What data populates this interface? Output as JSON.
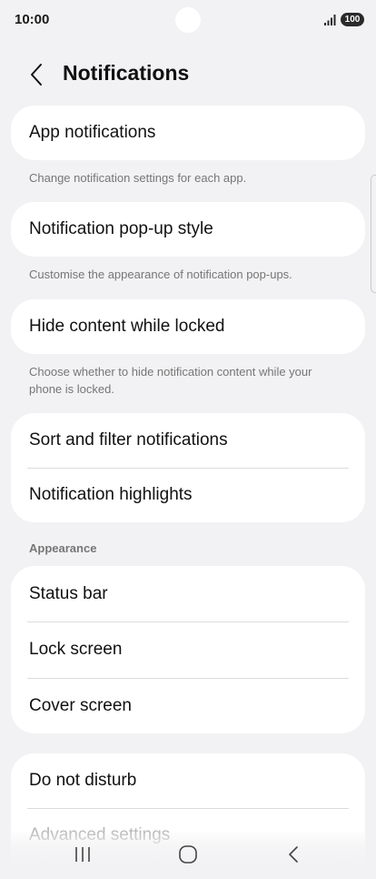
{
  "status_bar": {
    "time": "10:00",
    "battery": "100"
  },
  "header": {
    "title": "Notifications"
  },
  "groups": {
    "app_notifications": {
      "label": "App notifications",
      "desc": "Change notification settings for each app."
    },
    "popup_style": {
      "label": "Notification pop-up style",
      "desc": "Customise the appearance of notification pop-ups."
    },
    "hide_content": {
      "label": "Hide content while locked",
      "desc": "Choose whether to hide notification content while your phone is locked."
    },
    "sort_group": {
      "items": [
        "Sort and filter notifications",
        "Notification highlights"
      ]
    },
    "appearance": {
      "header": "Appearance",
      "items": [
        "Status bar",
        "Lock screen",
        "Cover screen"
      ]
    },
    "more": {
      "items": [
        "Do not disturb",
        "Advanced settings"
      ]
    }
  },
  "icons": {
    "back": "chevron-left-icon",
    "signal": "signal-icon",
    "nav_recents": "recents-icon",
    "nav_home": "home-icon",
    "nav_back": "back-icon"
  },
  "colors": {
    "background": "#f2f2f4",
    "card": "#ffffff",
    "secondary_text": "#767676",
    "divider": "#dcdcdc"
  }
}
